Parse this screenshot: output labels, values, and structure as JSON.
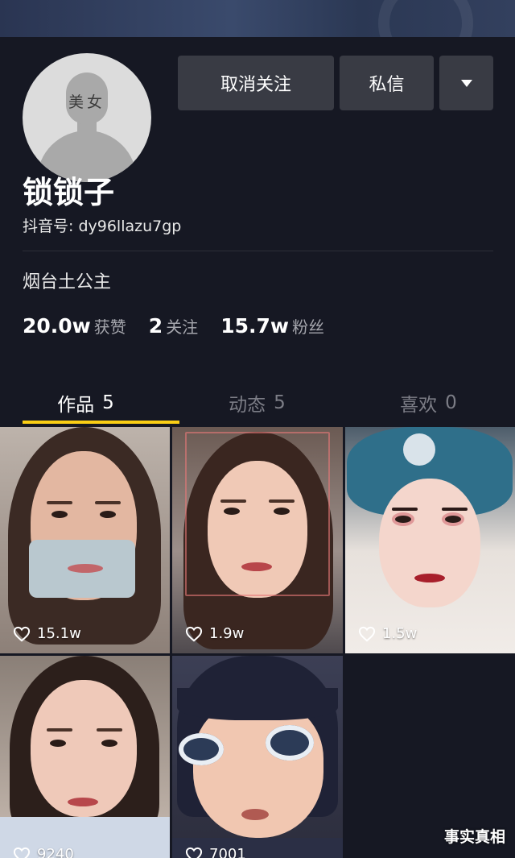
{
  "profile": {
    "avatar_text": "美女",
    "name": "锁锁子",
    "douyin_id": "抖音号: dy96llazu7gp",
    "bio": "烟台土公主"
  },
  "actions": {
    "unfollow_label": "取消关注",
    "message_label": "私信",
    "more_icon": "caret-down-icon"
  },
  "stats": {
    "likes_num": "20.0w",
    "likes_label": "获赞",
    "following_num": "2",
    "following_label": "关注",
    "followers_num": "15.7w",
    "followers_label": "粉丝"
  },
  "tabs": [
    {
      "label": "作品",
      "count": "5",
      "active": true
    },
    {
      "label": "动态",
      "count": "5",
      "active": false
    },
    {
      "label": "喜欢",
      "count": "0",
      "active": false
    }
  ],
  "videos": [
    {
      "likes": "15.1w"
    },
    {
      "likes": "1.9w"
    },
    {
      "likes": "1.5w"
    },
    {
      "likes": "9240"
    },
    {
      "likes": "7001"
    }
  ],
  "watermark": "事实真相",
  "colors": {
    "background": "#161823",
    "accent_underline": "#face15",
    "button": "#393b44"
  }
}
